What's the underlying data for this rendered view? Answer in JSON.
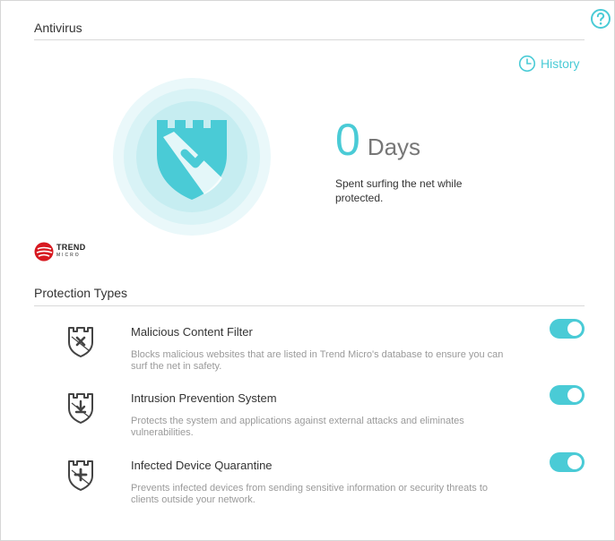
{
  "antivirus": {
    "title": "Antivirus",
    "history_label": "History",
    "days_value": "0",
    "days_unit": "Days",
    "days_description": "Spent surfing the net while protected."
  },
  "brand": {
    "logo_line1": "TREND",
    "logo_line2": "MICRO"
  },
  "protection": {
    "title": "Protection Types",
    "items": [
      {
        "name": "Malicious Content Filter",
        "description": "Blocks malicious websites that are listed in Trend Micro's database to ensure you can surf the net in safety.",
        "icon": "shield-x-icon",
        "enabled": true
      },
      {
        "name": "Intrusion Prevention System",
        "description": "Protects the system and applications against external attacks and eliminates vulnerabilities.",
        "icon": "shield-arrow-icon",
        "enabled": true
      },
      {
        "name": "Infected Device Quarantine",
        "description": "Prevents infected devices from sending sensitive information or security threats to clients outside your network.",
        "icon": "shield-plus-icon",
        "enabled": true
      }
    ]
  },
  "colors": {
    "accent": "#4acbd6",
    "brand_red": "#d71920"
  }
}
